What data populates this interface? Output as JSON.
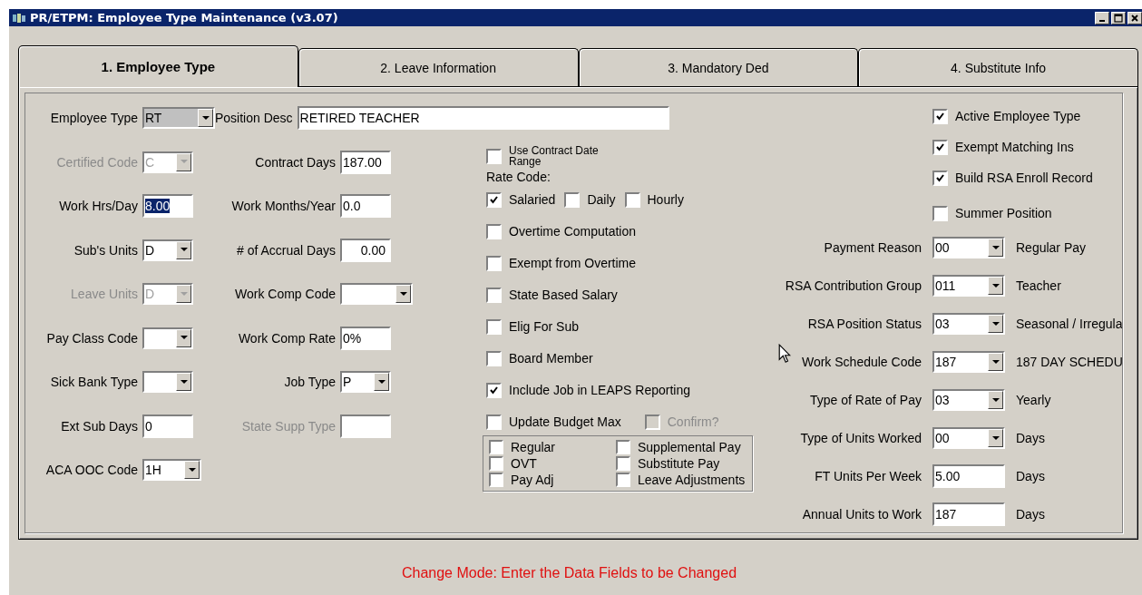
{
  "window": {
    "title": "PR/ETPM: Employee Type Maintenance (v3.07)"
  },
  "tabs": [
    {
      "label": "1. Employee Type",
      "selected": true
    },
    {
      "label": "2. Leave Information",
      "selected": false
    },
    {
      "label": "3. Mandatory Ded",
      "selected": false
    },
    {
      "label": "4. Substitute Info",
      "selected": false
    }
  ],
  "left_fields": [
    {
      "label": "Employee Type",
      "kind": "shaded_combo",
      "value": "RT",
      "disabled": false
    },
    {
      "label": "Certified Code",
      "kind": "combo",
      "value": "C",
      "disabled": true
    },
    {
      "label": "Work Hrs/Day",
      "kind": "selected_text",
      "value": "8.00",
      "disabled": false
    },
    {
      "label": "Sub's Units",
      "kind": "combo",
      "value": "D",
      "disabled": false
    },
    {
      "label": "Leave Units",
      "kind": "combo",
      "value": "D",
      "disabled": true
    },
    {
      "label": "Pay Class Code",
      "kind": "combo",
      "disabled": false
    },
    {
      "label": "Sick Bank Type",
      "kind": "combo",
      "disabled": false
    },
    {
      "label": "Ext Sub Days",
      "kind": "text",
      "value": "0",
      "disabled": false
    },
    {
      "label": "ACA OOC Code",
      "kind": "combo",
      "value": "1H",
      "disabled": false
    }
  ],
  "middle_fields": [
    {
      "label": "Position Desc",
      "kind": "wide_text",
      "value": "RETIRED TEACHER",
      "disabled": false
    },
    {
      "label": "Contract Days",
      "kind": "text",
      "value": "187.00",
      "disabled": false
    },
    {
      "label": "Work Months/Year",
      "kind": "text",
      "value": "0.0",
      "disabled": false
    },
    {
      "label": "# of Accrual Days",
      "kind": "number_text",
      "value": "0.00",
      "disabled": false
    },
    {
      "label": "Work Comp Code",
      "kind": "wide_combo",
      "disabled": false
    },
    {
      "label": "Work Comp Rate",
      "kind": "text",
      "value": "0%",
      "disabled": false
    },
    {
      "label": "Job Type",
      "kind": "combo",
      "value": "P",
      "disabled": false
    },
    {
      "label": "State Supp Type",
      "kind": "text",
      "disabled": true
    }
  ],
  "contract_date": {
    "label": "Use Contract Date Range",
    "checked": false
  },
  "rate_code": {
    "label": "Rate Code:",
    "options": [
      {
        "label": "Salaried",
        "checked": true
      },
      {
        "label": "Daily",
        "checked": false
      },
      {
        "label": "Hourly",
        "checked": false
      }
    ]
  },
  "middle_checks": [
    {
      "label": "Overtime Computation",
      "checked": false
    },
    {
      "label": "Exempt from Overtime",
      "checked": false
    },
    {
      "label": "State Based Salary",
      "checked": false
    },
    {
      "label": "Elig For Sub",
      "checked": false
    },
    {
      "label": "Board Member",
      "checked": false
    },
    {
      "label": "Include Job in LEAPS Reporting",
      "checked": true
    }
  ],
  "update_budget": {
    "label": "Update Budget Max",
    "checked": false,
    "confirm": {
      "label": "Confirm?",
      "checked": false,
      "disabled": true
    }
  },
  "pay_types": [
    {
      "label": "Regular",
      "checked": false
    },
    {
      "label": "Supplemental Pay",
      "checked": false
    },
    {
      "label": "OVT",
      "checked": false
    },
    {
      "label": "Substitute Pay",
      "checked": false
    },
    {
      "label": "Pay Adj",
      "checked": false
    },
    {
      "label": "Leave Adjustments",
      "checked": false
    }
  ],
  "right_checks": [
    {
      "label": "Active Employee Type",
      "checked": true
    },
    {
      "label": "Exempt Matching Ins",
      "checked": true
    },
    {
      "label": "Build RSA Enroll Record",
      "checked": true
    },
    {
      "label": "Summer Position",
      "checked": false
    }
  ],
  "right_fields": [
    {
      "label": "Payment Reason",
      "kind": "combo",
      "value": "00",
      "description": "Regular Pay"
    },
    {
      "label": "RSA Contribution Group",
      "kind": "combo",
      "value": "011",
      "description": "Teacher"
    },
    {
      "label": "RSA Position Status",
      "kind": "combo",
      "value": "03",
      "description": "Seasonal / Irregula"
    },
    {
      "label": "Work Schedule Code",
      "kind": "combo",
      "value": "187",
      "description": "187 DAY SCHEDU"
    },
    {
      "label": "Type of Rate of Pay",
      "kind": "combo",
      "value": "03",
      "description": "Yearly"
    },
    {
      "label": "Type of Units Worked",
      "kind": "combo",
      "value": "00",
      "description": "Days"
    },
    {
      "label": "FT Units Per Week",
      "kind": "text",
      "value": "5.00",
      "description": "Days"
    },
    {
      "label": "Annual Units to Work",
      "kind": "text",
      "value": "187",
      "description": "Days"
    }
  ],
  "status_bar": {
    "message": "Change Mode: Enter the Data Fields to be Changed"
  }
}
